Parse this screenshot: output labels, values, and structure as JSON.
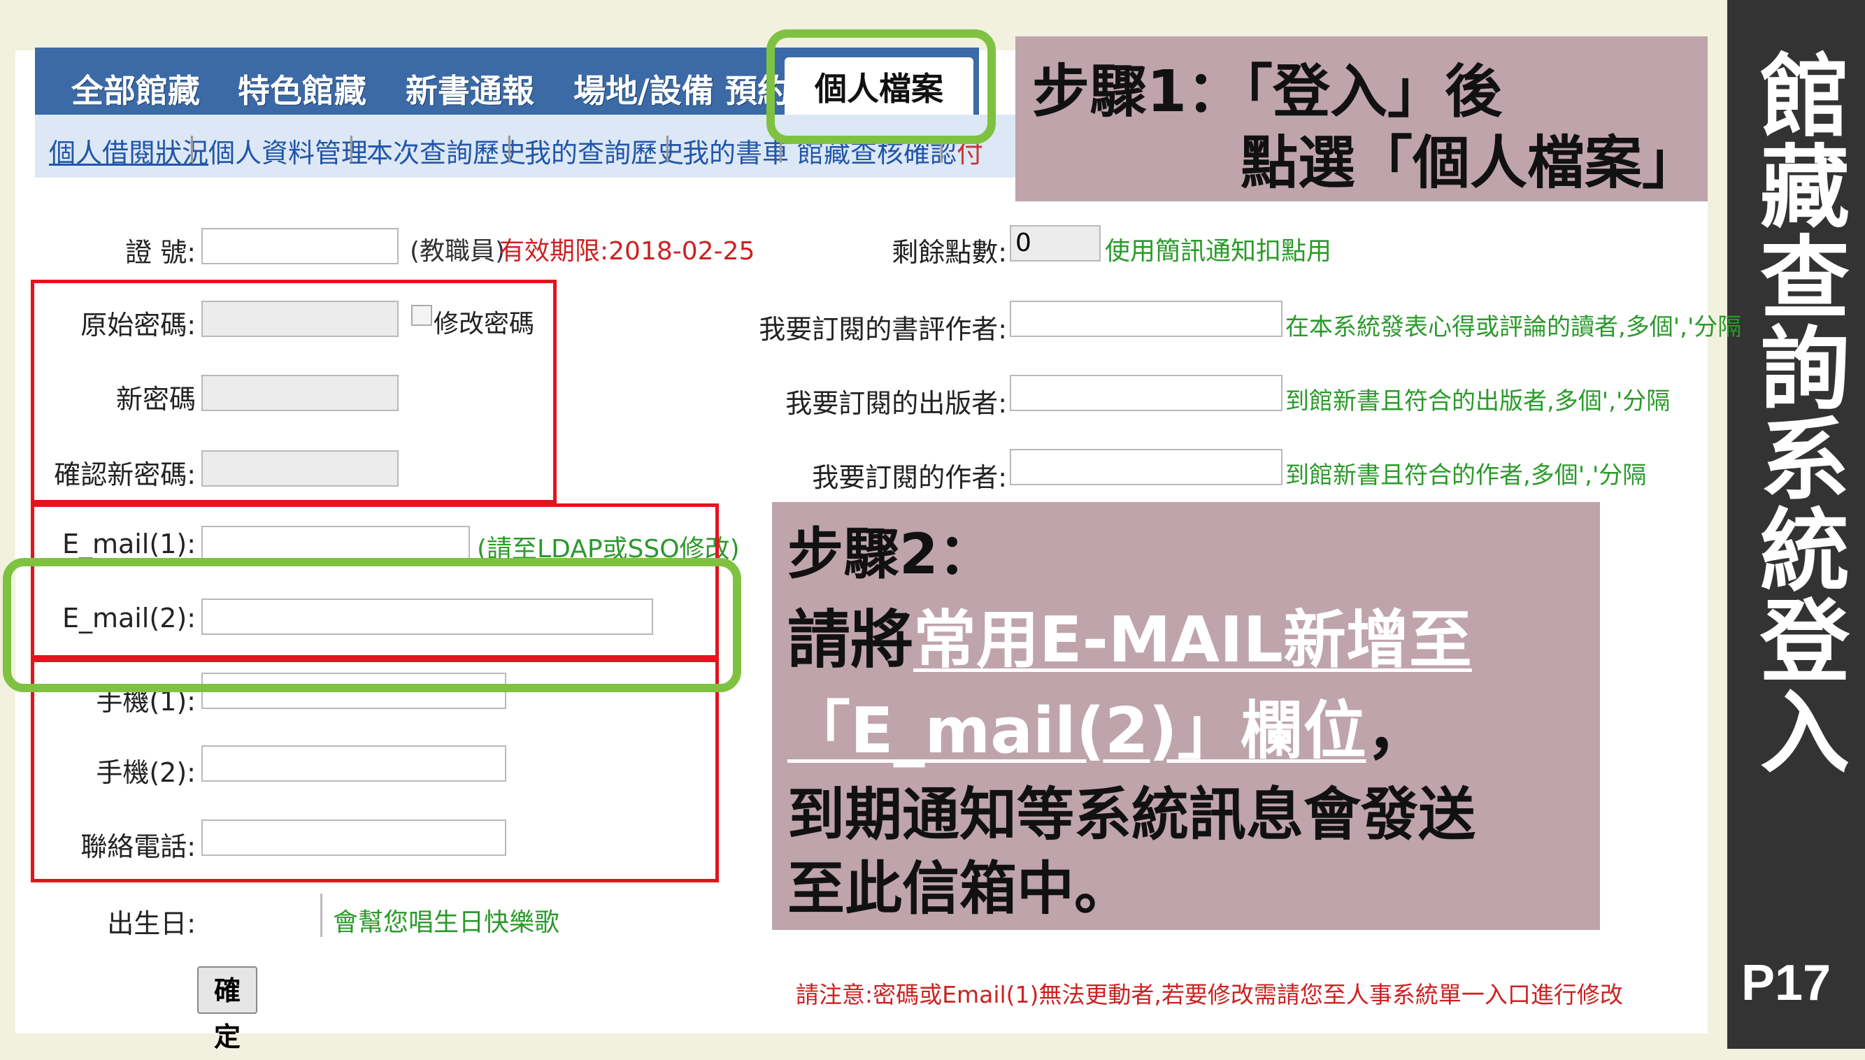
{
  "slide": {
    "side_title": "館藏查詢系統登入",
    "page_number": "P17"
  },
  "tabs": [
    "全部館藏",
    "特色館藏",
    "新書通報",
    "場地/設備 預約",
    "個人檔案"
  ],
  "subnav": [
    "個人借閱狀況",
    "個人資料管理",
    "本次查詢歷史",
    "我的查詢歷史",
    "我的書車",
    "館藏查核確認",
    "付"
  ],
  "form": {
    "id_label": "證 號:",
    "id_note_role": "(教職員)",
    "id_note_expiry": "有效期限:2018-02-25",
    "orig_pw_label": "原始密碼:",
    "change_pw_label": "修改密碼",
    "new_pw_label": "新密碼",
    "confirm_pw_label": "確認新密碼:",
    "email1_label": "E_mail(1):",
    "email1_note": "(請至LDAP或SSO修改)",
    "email2_label": "E_mail(2):",
    "mobile1_label": "手機(1):",
    "mobile2_label": "手機(2):",
    "phone_label": "聯絡電話:",
    "birthday_label": "出生日:",
    "birthday_note": "會幫您唱生日快樂歌",
    "confirm_button": "確 定",
    "points_label": "剩餘點數:",
    "points_value": "0",
    "points_note": "使用簡訊通知扣點用",
    "sub_reviewer_label": "我要訂閱的書評作者:",
    "sub_reviewer_note": "在本系統發表心得或評論的讀者,多個','分隔",
    "sub_publisher_label": "我要訂閱的出版者:",
    "sub_publisher_note": "到館新書且符合的出版者,多個','分隔",
    "sub_author_label": "我要訂閱的作者:",
    "sub_author_note": "到館新書且符合的作者,多個','分隔",
    "footer_note": "請注意:密碼或Email(1)無法更動者,若要修改需請您至人事系統單一入口進行修改"
  },
  "callout1": {
    "line1": "步驟1：「登入」後",
    "line2": "點選「個人檔案」"
  },
  "callout2": {
    "line1": "步驟2：",
    "line2_prefix": "請將",
    "line2_highlight": "常用E-MAIL新增至",
    "line3_highlight": "「E_mail(2)」欄位",
    "line3_suffix": "，",
    "line4": "到期通知等系統訊息會發送",
    "line5": "至此信箱中。"
  },
  "colors": {
    "highlight_red": "#e3141e",
    "highlight_green": "#7fc241",
    "callout_bg": "#bfa4ab",
    "tab_blue": "#3b6aa6"
  }
}
